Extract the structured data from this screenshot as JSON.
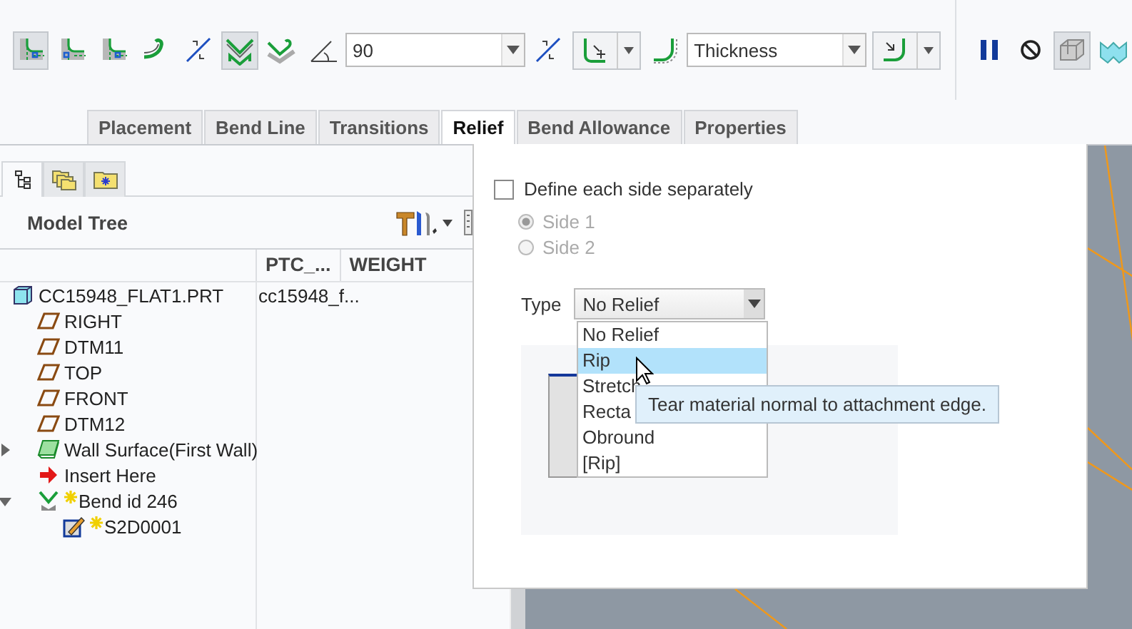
{
  "toolbar": {
    "items": [
      {
        "kind": "toggle",
        "selected": true
      },
      {
        "kind": "toggle",
        "selected": false
      },
      {
        "kind": "toggle",
        "selected": false
      },
      {
        "kind": "button"
      },
      {
        "kind": "button"
      },
      {
        "kind": "toggle",
        "selected": true
      },
      {
        "kind": "toggle",
        "selected": false
      },
      {
        "kind": "label-icon"
      },
      {
        "kind": "combo",
        "value": "90"
      },
      {
        "kind": "button"
      },
      {
        "kind": "split"
      },
      {
        "kind": "label-icon"
      },
      {
        "kind": "combo",
        "value": "Thickness"
      },
      {
        "kind": "split"
      },
      {
        "kind": "divider"
      },
      {
        "kind": "button"
      },
      {
        "kind": "toggle",
        "selected": false
      },
      {
        "kind": "toggle",
        "selected": true
      },
      {
        "kind": "toggle",
        "selected": false
      }
    ]
  },
  "tabs": [
    {
      "label": "Placement",
      "selected": false
    },
    {
      "label": "Bend Line",
      "selected": false
    },
    {
      "label": "Transitions",
      "selected": false
    },
    {
      "label": "Relief",
      "selected": true
    },
    {
      "label": "Bend Allowance",
      "selected": false
    },
    {
      "label": "Properties",
      "selected": false
    }
  ],
  "navigator": {
    "tabs": [
      {
        "selected": true
      },
      {
        "selected": false
      },
      {
        "selected": false
      }
    ],
    "title": "Model Tree",
    "columns": [
      "PTC_...",
      "WEIGHT"
    ],
    "tree": [
      {
        "kind": "part",
        "label": "CC15948_FLAT1.PRT",
        "cells": [
          "cc15948_f..."
        ],
        "children": [
          {
            "kind": "datum-plane",
            "label": "RIGHT"
          },
          {
            "kind": "datum-plane",
            "label": "DTM11"
          },
          {
            "kind": "datum-plane",
            "label": "TOP"
          },
          {
            "kind": "datum-plane",
            "label": "FRONT"
          },
          {
            "kind": "datum-plane",
            "label": "DTM12"
          },
          {
            "kind": "wall",
            "label": "Wall Surface(First Wall)",
            "expanded": false
          },
          {
            "kind": "insert",
            "label": "Insert Here"
          },
          {
            "kind": "bend",
            "label": "Bend id 246",
            "new": true,
            "expanded": true,
            "children": [
              {
                "kind": "sketch",
                "label": "S2D0001",
                "new": true
              }
            ]
          }
        ]
      }
    ]
  },
  "relief": {
    "separate_sides": {
      "label": "Define each side separately",
      "checked": false
    },
    "sides": [
      {
        "label": "Side 1",
        "selected": true,
        "disabled": true
      },
      {
        "label": "Side 2",
        "selected": false,
        "disabled": true
      }
    ],
    "type_label": "Type",
    "type_value": "No Relief",
    "options": [
      {
        "label": "No Relief",
        "selected": false
      },
      {
        "label": "Rip",
        "selected": true
      },
      {
        "label": "Stretch",
        "selected": false
      },
      {
        "label": "Recta",
        "selected": false
      },
      {
        "label": "Obround",
        "selected": false
      },
      {
        "label": "[Rip]",
        "selected": false
      }
    ],
    "tooltip": "Tear material normal to attachment edge."
  }
}
